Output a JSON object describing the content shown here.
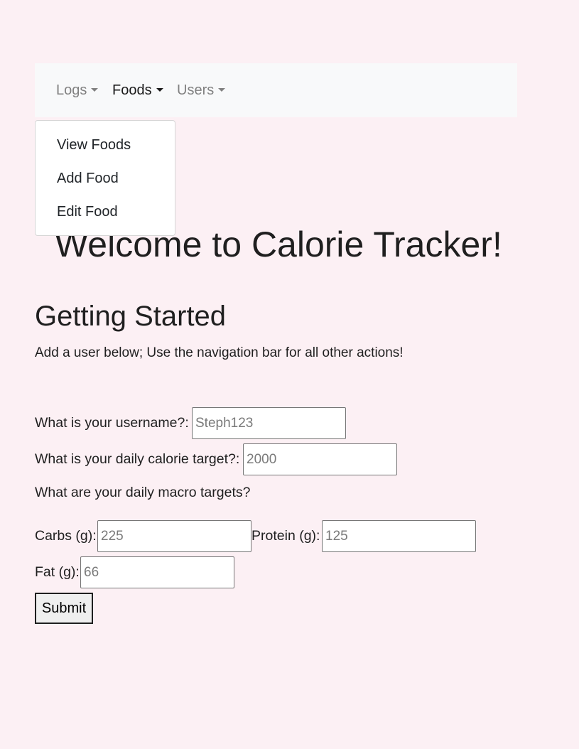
{
  "nav": {
    "items": [
      {
        "label": "Logs",
        "active": false
      },
      {
        "label": "Foods",
        "active": true
      },
      {
        "label": "Users",
        "active": false
      }
    ]
  },
  "dropdown": {
    "items": [
      "View Foods",
      "Add Food",
      "Edit Food"
    ]
  },
  "page": {
    "title": "Welcome to Calorie Tracker!",
    "subtitle": "Getting Started",
    "intro": "Add a user below; Use the navigation bar for all other actions!"
  },
  "form": {
    "username_label": "What is your username?:",
    "username_placeholder": "Steph123",
    "calorie_label": "What is your daily calorie target?:",
    "calorie_placeholder": "2000",
    "macro_label": "What are your daily macro targets?",
    "carbs_label": "Carbs (g):",
    "carbs_placeholder": "225",
    "protein_label": "Protein (g):",
    "protein_placeholder": "125",
    "fat_label": "Fat (g):",
    "fat_placeholder": "66",
    "submit_label": "Submit"
  },
  "colors": {
    "page_background": "#fcf0f4",
    "navbar_background": "#f8f9fa",
    "nav_inactive": "#808080",
    "nav_active": "#1a1a1a"
  }
}
